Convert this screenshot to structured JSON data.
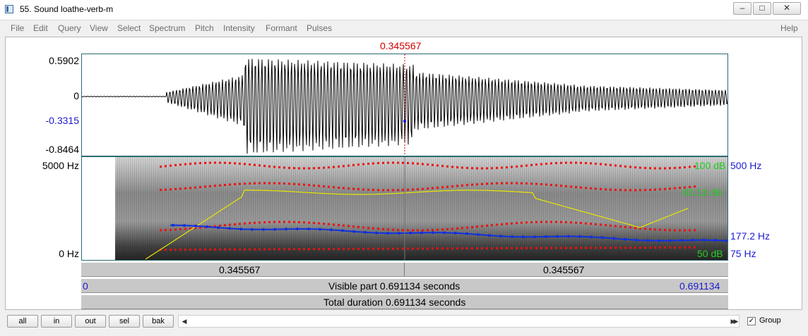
{
  "window": {
    "title": "55. Sound loathe-verb-m",
    "controls": [
      "minimize-icon",
      "maximize-icon",
      "close-icon"
    ]
  },
  "menu": [
    "File",
    "Edit",
    "Query",
    "View",
    "Select",
    "Spectrum",
    "Pitch",
    "Intensity",
    "Formant",
    "Pulses",
    "Help"
  ],
  "cursor_time": "0.345567",
  "waveform": {
    "y_max": "0.5902",
    "y_zero": "0",
    "y_cursor": "-0.3315",
    "y_min": "-0.8464"
  },
  "spectrogram": {
    "freq_top": "5000 Hz",
    "freq_bottom": "0 Hz",
    "intensity_top": "100 dB",
    "intensity_cursor": "83.13 dB",
    "intensity_bottom": "50 dB",
    "pitch_top": "500 Hz",
    "pitch_cursor": "177.2 Hz",
    "pitch_bottom": "75 Hz"
  },
  "time_bars": {
    "left_segment": "0.345567",
    "right_segment": "0.345567",
    "visible_start": "0",
    "visible_label": "Visible part 0.691134 seconds",
    "visible_end": "0.691134",
    "total_label": "Total duration 0.691134 seconds"
  },
  "bottom_buttons": [
    "all",
    "in",
    "out",
    "sel",
    "bak"
  ],
  "group_label": "Group",
  "group_checked": true,
  "colors": {
    "cursor": "#d00000",
    "blue_label": "#1a1ad0",
    "green_label": "#22cc22",
    "formant": "#ee1010",
    "pitch": "#1030e0",
    "intensity": "#e8e800"
  }
}
